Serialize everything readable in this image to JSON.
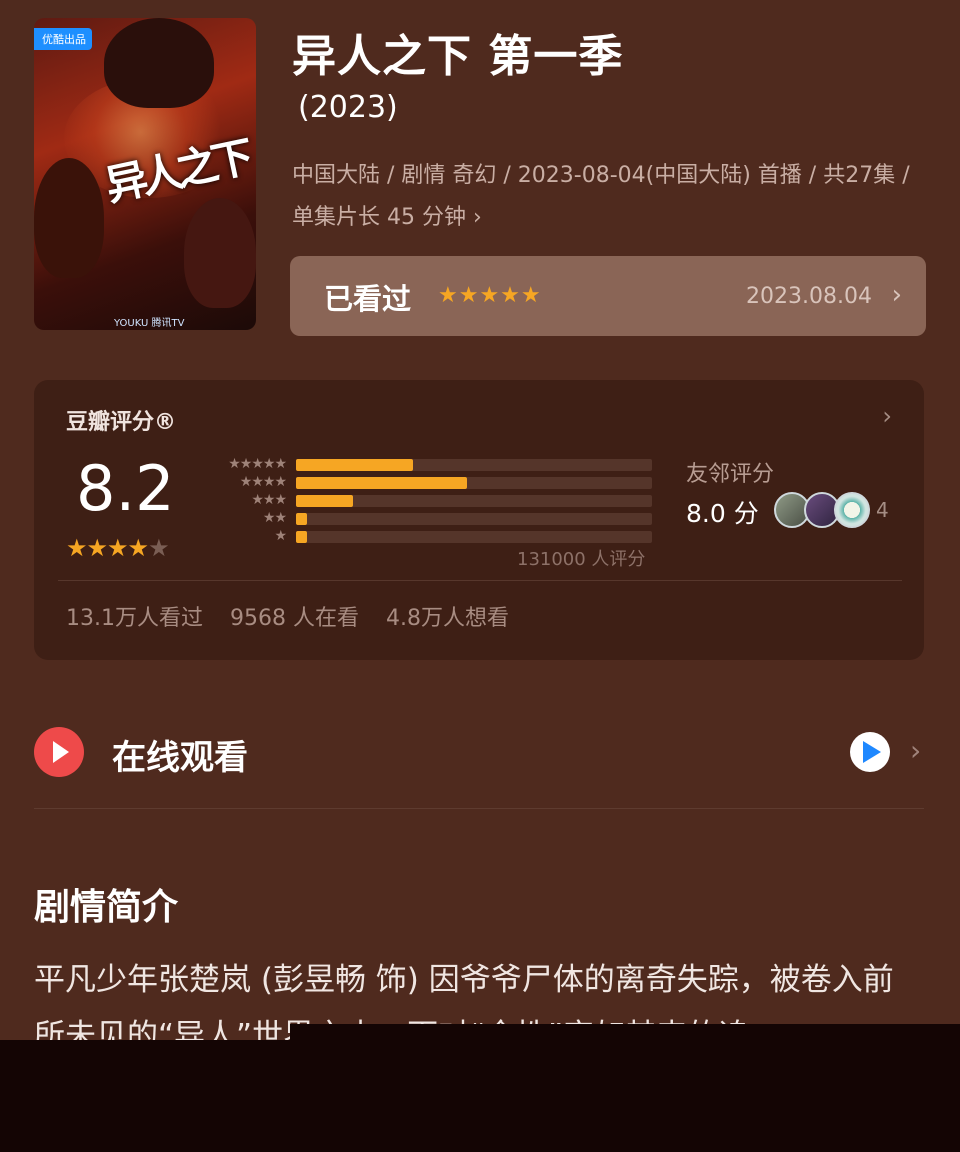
{
  "poster": {
    "badge": "优酷出品",
    "title_art": "异人之下",
    "logos": "YOUKU 腾讯TV"
  },
  "header": {
    "title": "异人之下 第一季",
    "year": "(2023)",
    "meta": "中国大陆 / 剧情 奇幻 / 2023-08-04(中国大陆) 首播 / 共27集 / 单集片长 45 分钟 ›"
  },
  "watched": {
    "label": "已看过",
    "stars": "★★★★★",
    "date": "2023.08.04",
    "chevron": "›"
  },
  "rating": {
    "heading": "豆瓣评分®",
    "score": "8.2",
    "avg_stars_full": "★★★★",
    "avg_stars_empty": "★",
    "distribution": [
      {
        "stars": "★★★★★",
        "fraction": 0.33
      },
      {
        "stars": "★★★★",
        "fraction": 0.48
      },
      {
        "stars": "★★★",
        "fraction": 0.16
      },
      {
        "stars": "★★",
        "fraction": 0.03
      },
      {
        "stars": "★",
        "fraction": 0.03
      }
    ],
    "count": "131000 人评分",
    "neighbor_label": "友邻评分",
    "neighbor_score": "8.0 分",
    "neighbor_count": "4",
    "stats": [
      "13.1万人看过",
      "9568 人在看",
      "4.8万人想看"
    ],
    "chevron": "›"
  },
  "online": {
    "label": "在线观看",
    "chevron": "›",
    "icons": [
      "play-icon",
      "youku-app-icon"
    ]
  },
  "synopsis": {
    "title": "剧情简介",
    "text": "平凡少年张楚岚 (彭昱畅 饰) 因爷爷尸体的离奇失踪，被卷入前所未见的“异人”世界之中，面对“全性”突如其来的追"
  },
  "colors": {
    "background": "#4f2a1e",
    "star": "#f6a623",
    "play": "#ee4a4a"
  }
}
